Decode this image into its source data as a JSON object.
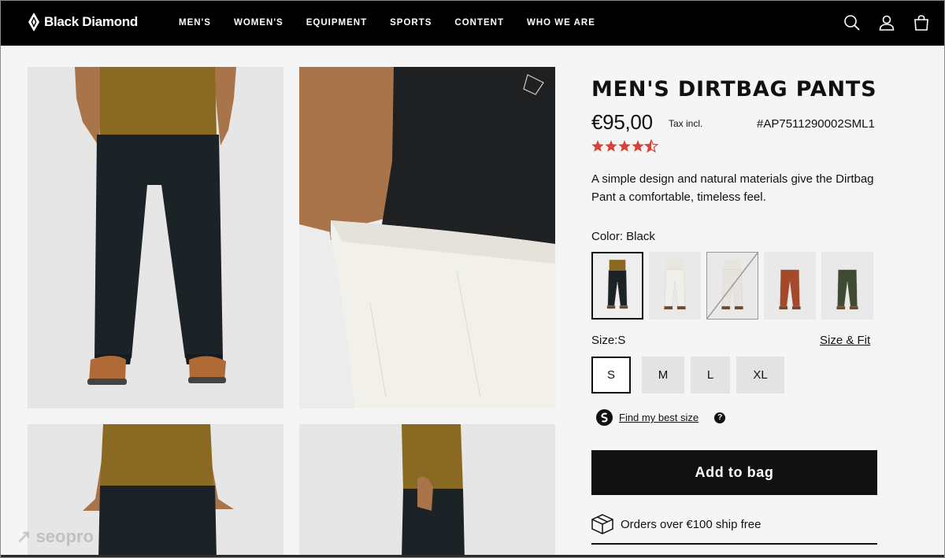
{
  "brand": {
    "name": "Black Diamond"
  },
  "nav": {
    "items": [
      "MEN'S",
      "WOMEN'S",
      "EQUIPMENT",
      "SPORTS",
      "CONTENT",
      "WHO WE ARE"
    ]
  },
  "header_icons": [
    "search-icon",
    "account-icon",
    "bag-icon"
  ],
  "product": {
    "title": "MEN'S DIRTBAG PANTS",
    "price": "€95,00",
    "tax_note": "Tax incl.",
    "sku": "#AP7511290002SML1",
    "rating": 4.5,
    "rating_max": 5,
    "description": "A simple design and natural materials give the Dirtbag Pant a comfortable, timeless feel.",
    "color_label": "Color: Black",
    "colors": [
      {
        "name": "black",
        "pants": "#1b2327",
        "shirt": "#8a6a22",
        "selected": true,
        "available": true
      },
      {
        "name": "white",
        "pants": "#f0efe9",
        "shirt": "#e9e6dd",
        "selected": false,
        "available": true
      },
      {
        "name": "natural",
        "pants": "#e6e4dc",
        "shirt": "#e6e4dc",
        "selected": false,
        "available": false
      },
      {
        "name": "rust",
        "pants": "#a44a2a",
        "shirt": "#e9e9e9",
        "selected": false,
        "available": true
      },
      {
        "name": "olive",
        "pants": "#3f4a33",
        "shirt": "#e9e9e9",
        "selected": false,
        "available": true
      }
    ],
    "size_label": "Size:S",
    "size_fit_link": "Size & Fit",
    "sizes": [
      {
        "label": "S",
        "selected": true
      },
      {
        "label": "M",
        "selected": false
      },
      {
        "label": "L",
        "selected": false
      },
      {
        "label": "XL",
        "selected": false
      }
    ],
    "find_size_link": "Find my best size",
    "help_icon": "?",
    "add_to_bag": "Add to bag",
    "shipping_note": "Orders over €100 ship free"
  },
  "watermark": "seopro",
  "colors": {
    "header_bg": "#000000",
    "accent_star": "#d9423b",
    "button_bg": "#111111",
    "page_bg": "#f5f5f5"
  }
}
